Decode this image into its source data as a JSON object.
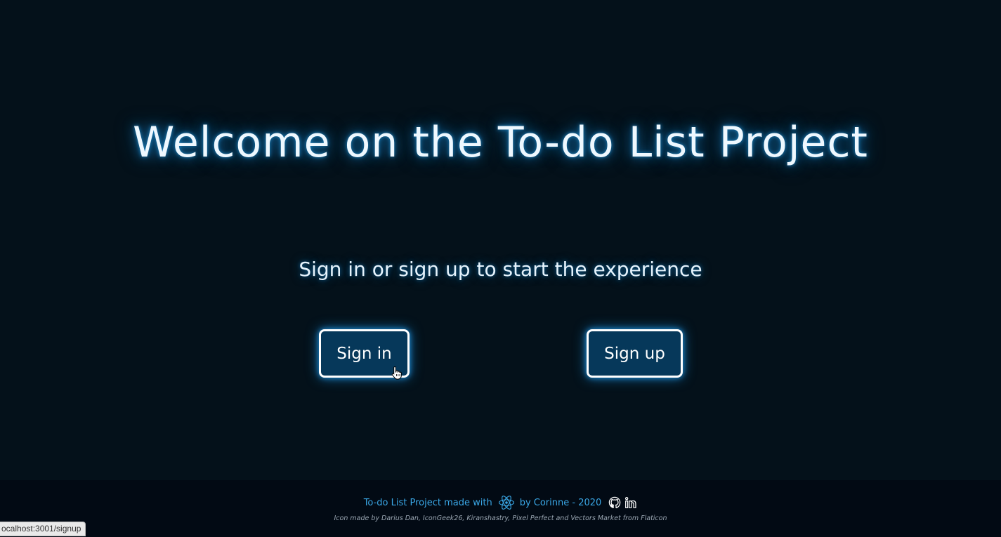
{
  "hero": {
    "title": "Welcome on the To-do List Project",
    "subtitle": "Sign in or sign up to start the experience"
  },
  "buttons": {
    "sign_in": "Sign in",
    "sign_up": "Sign up"
  },
  "footer": {
    "made_with": "To-do List Project made with",
    "by": "by Corinne - 2020",
    "credit": "Icon made by Darius Dan, IconGeek26, Kiranshastry, Pixel Perfect and Vectors Market from Flaticon",
    "icons": [
      "react-icon",
      "github-icon",
      "linkedin-icon"
    ]
  },
  "statusbar": {
    "url": "ocalhost:3001/signup"
  },
  "colors": {
    "background": "#04111a",
    "button_bg": "#06385a",
    "accent": "#3aa7e6",
    "glow": "#1e86c4",
    "footer_bg": "#020a14"
  }
}
